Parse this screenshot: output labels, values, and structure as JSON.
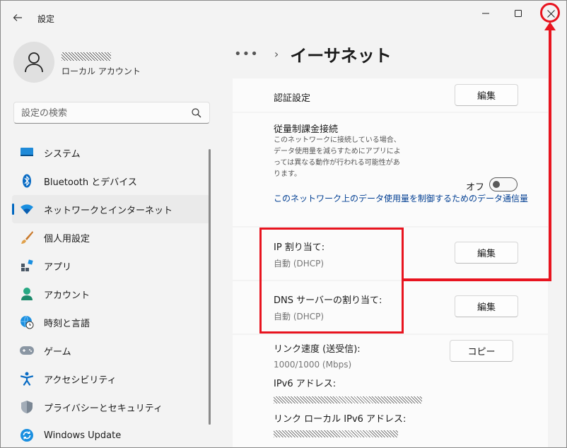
{
  "window": {
    "app_title": "設定",
    "back_icon": "arrow-left-icon",
    "minimize_icon": "minimize-icon",
    "maximize_icon": "maximize-icon",
    "close_icon": "close-icon"
  },
  "user": {
    "account_type": "ローカル アカウント"
  },
  "search": {
    "placeholder": "設定の検索"
  },
  "sidebar": {
    "items": [
      {
        "label": "システム",
        "icon": "system-icon"
      },
      {
        "label": "Bluetooth とデバイス",
        "icon": "bluetooth-icon"
      },
      {
        "label": "ネットワークとインターネット",
        "icon": "network-icon",
        "active": true
      },
      {
        "label": "個人用設定",
        "icon": "brush-icon"
      },
      {
        "label": "アプリ",
        "icon": "apps-icon"
      },
      {
        "label": "アカウント",
        "icon": "account-icon"
      },
      {
        "label": "時刻と言語",
        "icon": "globe-clock-icon"
      },
      {
        "label": "ゲーム",
        "icon": "gamepad-icon"
      },
      {
        "label": "アクセシビリティ",
        "icon": "accessibility-icon"
      },
      {
        "label": "プライバシーとセキュリティ",
        "icon": "shield-icon"
      },
      {
        "label": "Windows Update",
        "icon": "update-icon"
      }
    ]
  },
  "breadcrumb": {
    "more": "•••",
    "separator": "›",
    "title": "イーサネット"
  },
  "settings": {
    "auth": {
      "label": "認証設定",
      "button": "編集"
    },
    "metered": {
      "label": "従量制課金接続",
      "description": "このネットワークに接続している場合、データ使用量を減らすためにアプリによっては異なる動作が行われる可能性があります。",
      "toggle_state": "オフ",
      "toggle_on": false,
      "link": "このネットワーク上のデータ使用量を制御するためのデータ通信量"
    },
    "ip": {
      "label": "IP 割り当て:",
      "value": "自動 (DHCP)",
      "button": "編集"
    },
    "dns": {
      "label": "DNS サーバーの割り当て:",
      "value": "自動 (DHCP)",
      "button": "編集"
    },
    "link_speed": {
      "label": "リンク速度 (送受信):",
      "value": "1000/1000 (Mbps)",
      "button": "コピー"
    },
    "ipv6": {
      "label": "IPv6 アドレス:"
    },
    "link_local_ipv6": {
      "label": "リンク ローカル IPv6 アドレス:"
    }
  },
  "colors": {
    "accent": "#0067c0",
    "annotation": "#e8141f",
    "link": "#003e92"
  }
}
